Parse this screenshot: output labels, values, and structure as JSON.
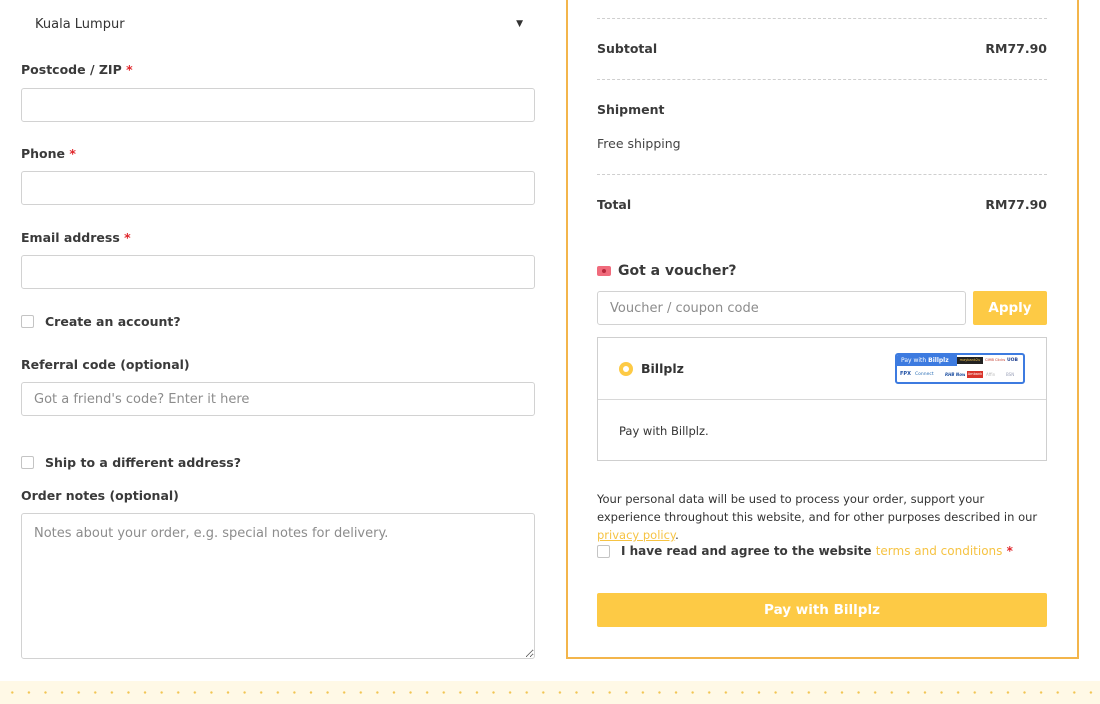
{
  "billing": {
    "city_value": "Kuala Lumpur",
    "postcode_label": "Postcode / ZIP",
    "phone_label": "Phone",
    "email_label": "Email address",
    "required_mark": "*",
    "create_account_label": "Create an account?",
    "referral_label": "Referral code (optional)",
    "referral_placeholder": "Got a friend's code? Enter it here",
    "ship_different_label": "Ship to a different address?",
    "order_notes_label": "Order notes (optional)",
    "order_notes_placeholder": "Notes about your order, e.g. special notes for delivery."
  },
  "summary": {
    "subtotal_label": "Subtotal",
    "subtotal_value": "RM77.90",
    "shipment_label": "Shipment",
    "shipment_value": "Free shipping",
    "total_label": "Total",
    "total_value": "RM77.90"
  },
  "voucher": {
    "title": "Got a voucher?",
    "placeholder": "Voucher / coupon code",
    "apply_label": "Apply"
  },
  "payment": {
    "method_name": "Billplz",
    "banner_title_prefix": "Pay with",
    "banner_title_brand": "Billplz",
    "banner_tiles": [
      "maybank2u",
      "CIMB Clicks",
      "UOB",
      "FPX",
      "Connect",
      "RHB Now",
      "Ambank",
      "Affin",
      "BSN"
    ],
    "description": "Pay with Billplz.",
    "privacy_text": "Your personal data will be used to process your order, support your experience throughout this website, and for other purposes described in our",
    "privacy_link": "privacy policy",
    "privacy_end": ".",
    "terms_text": "I have read and agree to the website",
    "terms_link": "terms and conditions",
    "pay_button_label": "Pay with Billplz"
  },
  "colors": {
    "accent": "#fdca45",
    "panel_border": "#f3b54b",
    "link": "#f6c343",
    "required": "#e0262b"
  }
}
